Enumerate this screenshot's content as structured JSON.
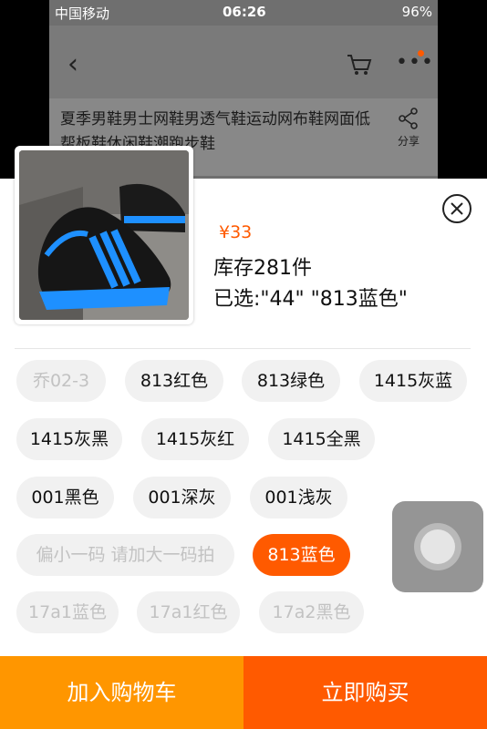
{
  "status_bar": {
    "carrier": "中国移动",
    "time": "06:26",
    "battery": "96%"
  },
  "product": {
    "title": "夏季男鞋男士网鞋男透气鞋运动网布鞋网面低帮板鞋休闲鞋潮跑步鞋",
    "share_label": "分享"
  },
  "sku_panel": {
    "price": "¥33",
    "stock": "库存281件",
    "selected": "已选:\"44\" \"813蓝色\""
  },
  "options": [
    {
      "label": "乔02-3",
      "state": "disabled"
    },
    {
      "label": "813红色",
      "state": "normal"
    },
    {
      "label": "813绿色",
      "state": "normal"
    },
    {
      "label": "1415灰蓝",
      "state": "normal"
    },
    {
      "label": "1415灰黑",
      "state": "normal"
    },
    {
      "label": "1415灰红",
      "state": "normal"
    },
    {
      "label": "1415全黑",
      "state": "normal"
    },
    {
      "label": "001黑色",
      "state": "normal"
    },
    {
      "label": "001深灰",
      "state": "normal"
    },
    {
      "label": "001浅灰",
      "state": "normal"
    },
    {
      "label": "偏小一码 请加大一码拍",
      "state": "disabled"
    },
    {
      "label": "813蓝色",
      "state": "selected"
    },
    {
      "label": "17a1蓝色",
      "state": "disabled"
    },
    {
      "label": "17a1红色",
      "state": "disabled"
    },
    {
      "label": "17a2黑色",
      "state": "disabled"
    }
  ],
  "actions": {
    "add_to_cart": "加入购物车",
    "buy_now": "立即购买"
  },
  "colors": {
    "accent": "#ff5a00",
    "cart_button": "#ff9600",
    "chip_bg": "#f1f1f1"
  }
}
